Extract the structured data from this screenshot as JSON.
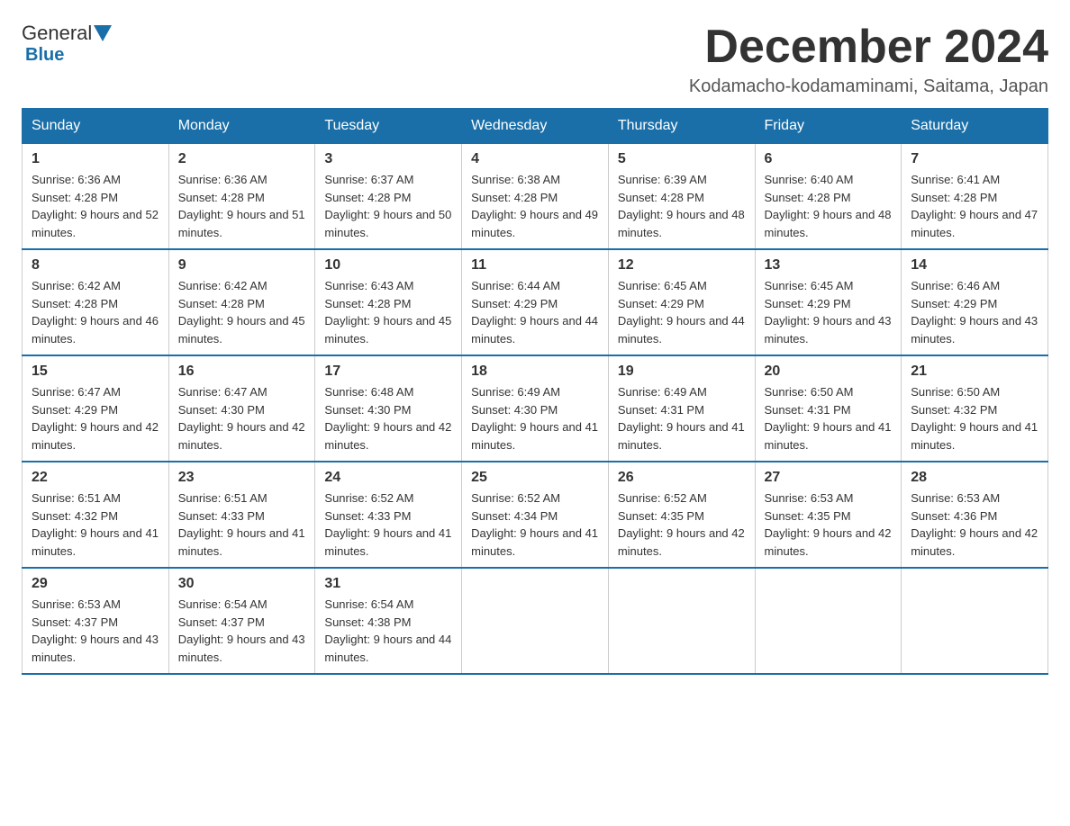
{
  "header": {
    "logo_general": "General",
    "logo_blue": "Blue",
    "month_title": "December 2024",
    "location": "Kodamacho-kodamaminami, Saitama, Japan"
  },
  "weekdays": [
    "Sunday",
    "Monday",
    "Tuesday",
    "Wednesday",
    "Thursday",
    "Friday",
    "Saturday"
  ],
  "weeks": [
    [
      {
        "day": "1",
        "sunrise": "Sunrise: 6:36 AM",
        "sunset": "Sunset: 4:28 PM",
        "daylight": "Daylight: 9 hours and 52 minutes."
      },
      {
        "day": "2",
        "sunrise": "Sunrise: 6:36 AM",
        "sunset": "Sunset: 4:28 PM",
        "daylight": "Daylight: 9 hours and 51 minutes."
      },
      {
        "day": "3",
        "sunrise": "Sunrise: 6:37 AM",
        "sunset": "Sunset: 4:28 PM",
        "daylight": "Daylight: 9 hours and 50 minutes."
      },
      {
        "day": "4",
        "sunrise": "Sunrise: 6:38 AM",
        "sunset": "Sunset: 4:28 PM",
        "daylight": "Daylight: 9 hours and 49 minutes."
      },
      {
        "day": "5",
        "sunrise": "Sunrise: 6:39 AM",
        "sunset": "Sunset: 4:28 PM",
        "daylight": "Daylight: 9 hours and 48 minutes."
      },
      {
        "day": "6",
        "sunrise": "Sunrise: 6:40 AM",
        "sunset": "Sunset: 4:28 PM",
        "daylight": "Daylight: 9 hours and 48 minutes."
      },
      {
        "day": "7",
        "sunrise": "Sunrise: 6:41 AM",
        "sunset": "Sunset: 4:28 PM",
        "daylight": "Daylight: 9 hours and 47 minutes."
      }
    ],
    [
      {
        "day": "8",
        "sunrise": "Sunrise: 6:42 AM",
        "sunset": "Sunset: 4:28 PM",
        "daylight": "Daylight: 9 hours and 46 minutes."
      },
      {
        "day": "9",
        "sunrise": "Sunrise: 6:42 AM",
        "sunset": "Sunset: 4:28 PM",
        "daylight": "Daylight: 9 hours and 45 minutes."
      },
      {
        "day": "10",
        "sunrise": "Sunrise: 6:43 AM",
        "sunset": "Sunset: 4:28 PM",
        "daylight": "Daylight: 9 hours and 45 minutes."
      },
      {
        "day": "11",
        "sunrise": "Sunrise: 6:44 AM",
        "sunset": "Sunset: 4:29 PM",
        "daylight": "Daylight: 9 hours and 44 minutes."
      },
      {
        "day": "12",
        "sunrise": "Sunrise: 6:45 AM",
        "sunset": "Sunset: 4:29 PM",
        "daylight": "Daylight: 9 hours and 44 minutes."
      },
      {
        "day": "13",
        "sunrise": "Sunrise: 6:45 AM",
        "sunset": "Sunset: 4:29 PM",
        "daylight": "Daylight: 9 hours and 43 minutes."
      },
      {
        "day": "14",
        "sunrise": "Sunrise: 6:46 AM",
        "sunset": "Sunset: 4:29 PM",
        "daylight": "Daylight: 9 hours and 43 minutes."
      }
    ],
    [
      {
        "day": "15",
        "sunrise": "Sunrise: 6:47 AM",
        "sunset": "Sunset: 4:29 PM",
        "daylight": "Daylight: 9 hours and 42 minutes."
      },
      {
        "day": "16",
        "sunrise": "Sunrise: 6:47 AM",
        "sunset": "Sunset: 4:30 PM",
        "daylight": "Daylight: 9 hours and 42 minutes."
      },
      {
        "day": "17",
        "sunrise": "Sunrise: 6:48 AM",
        "sunset": "Sunset: 4:30 PM",
        "daylight": "Daylight: 9 hours and 42 minutes."
      },
      {
        "day": "18",
        "sunrise": "Sunrise: 6:49 AM",
        "sunset": "Sunset: 4:30 PM",
        "daylight": "Daylight: 9 hours and 41 minutes."
      },
      {
        "day": "19",
        "sunrise": "Sunrise: 6:49 AM",
        "sunset": "Sunset: 4:31 PM",
        "daylight": "Daylight: 9 hours and 41 minutes."
      },
      {
        "day": "20",
        "sunrise": "Sunrise: 6:50 AM",
        "sunset": "Sunset: 4:31 PM",
        "daylight": "Daylight: 9 hours and 41 minutes."
      },
      {
        "day": "21",
        "sunrise": "Sunrise: 6:50 AM",
        "sunset": "Sunset: 4:32 PM",
        "daylight": "Daylight: 9 hours and 41 minutes."
      }
    ],
    [
      {
        "day": "22",
        "sunrise": "Sunrise: 6:51 AM",
        "sunset": "Sunset: 4:32 PM",
        "daylight": "Daylight: 9 hours and 41 minutes."
      },
      {
        "day": "23",
        "sunrise": "Sunrise: 6:51 AM",
        "sunset": "Sunset: 4:33 PM",
        "daylight": "Daylight: 9 hours and 41 minutes."
      },
      {
        "day": "24",
        "sunrise": "Sunrise: 6:52 AM",
        "sunset": "Sunset: 4:33 PM",
        "daylight": "Daylight: 9 hours and 41 minutes."
      },
      {
        "day": "25",
        "sunrise": "Sunrise: 6:52 AM",
        "sunset": "Sunset: 4:34 PM",
        "daylight": "Daylight: 9 hours and 41 minutes."
      },
      {
        "day": "26",
        "sunrise": "Sunrise: 6:52 AM",
        "sunset": "Sunset: 4:35 PM",
        "daylight": "Daylight: 9 hours and 42 minutes."
      },
      {
        "day": "27",
        "sunrise": "Sunrise: 6:53 AM",
        "sunset": "Sunset: 4:35 PM",
        "daylight": "Daylight: 9 hours and 42 minutes."
      },
      {
        "day": "28",
        "sunrise": "Sunrise: 6:53 AM",
        "sunset": "Sunset: 4:36 PM",
        "daylight": "Daylight: 9 hours and 42 minutes."
      }
    ],
    [
      {
        "day": "29",
        "sunrise": "Sunrise: 6:53 AM",
        "sunset": "Sunset: 4:37 PM",
        "daylight": "Daylight: 9 hours and 43 minutes."
      },
      {
        "day": "30",
        "sunrise": "Sunrise: 6:54 AM",
        "sunset": "Sunset: 4:37 PM",
        "daylight": "Daylight: 9 hours and 43 minutes."
      },
      {
        "day": "31",
        "sunrise": "Sunrise: 6:54 AM",
        "sunset": "Sunset: 4:38 PM",
        "daylight": "Daylight: 9 hours and 44 minutes."
      },
      null,
      null,
      null,
      null
    ]
  ]
}
